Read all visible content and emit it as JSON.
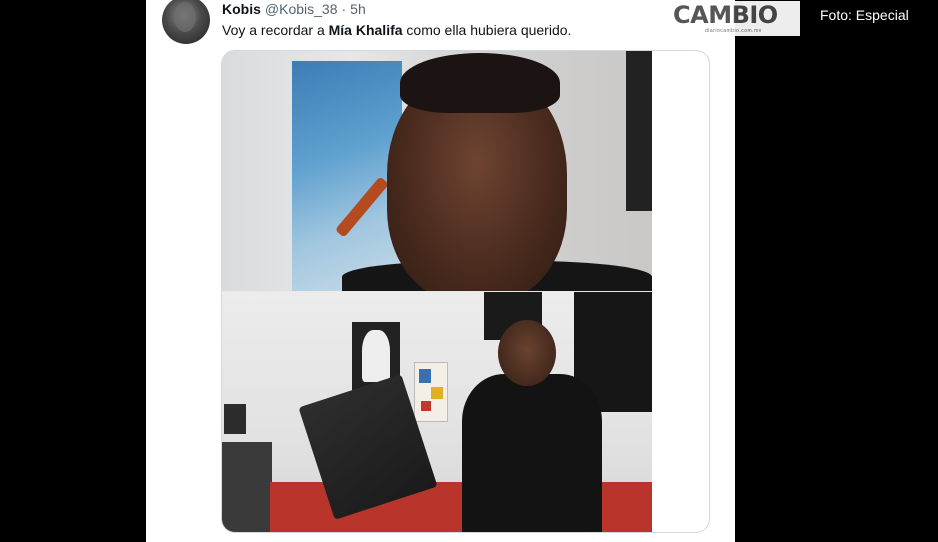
{
  "tweet": {
    "display_name": "Kobis",
    "handle": "@Kobis_38",
    "separator": "·",
    "time": "5h",
    "text_before": "Voy a recordar a ",
    "text_bold": "Mía Khalifa",
    "text_after": " como ella hubiera querido."
  },
  "watermark": {
    "logo": "CAMBIO",
    "logo_sub": "diariocambio.com.mx"
  },
  "photo_credit": "Foto: Especial",
  "colors": {
    "background": "#000000",
    "card": "#ffffff",
    "name": "#0f1419",
    "meta": "#536471",
    "media_border": "#cfd9de"
  }
}
